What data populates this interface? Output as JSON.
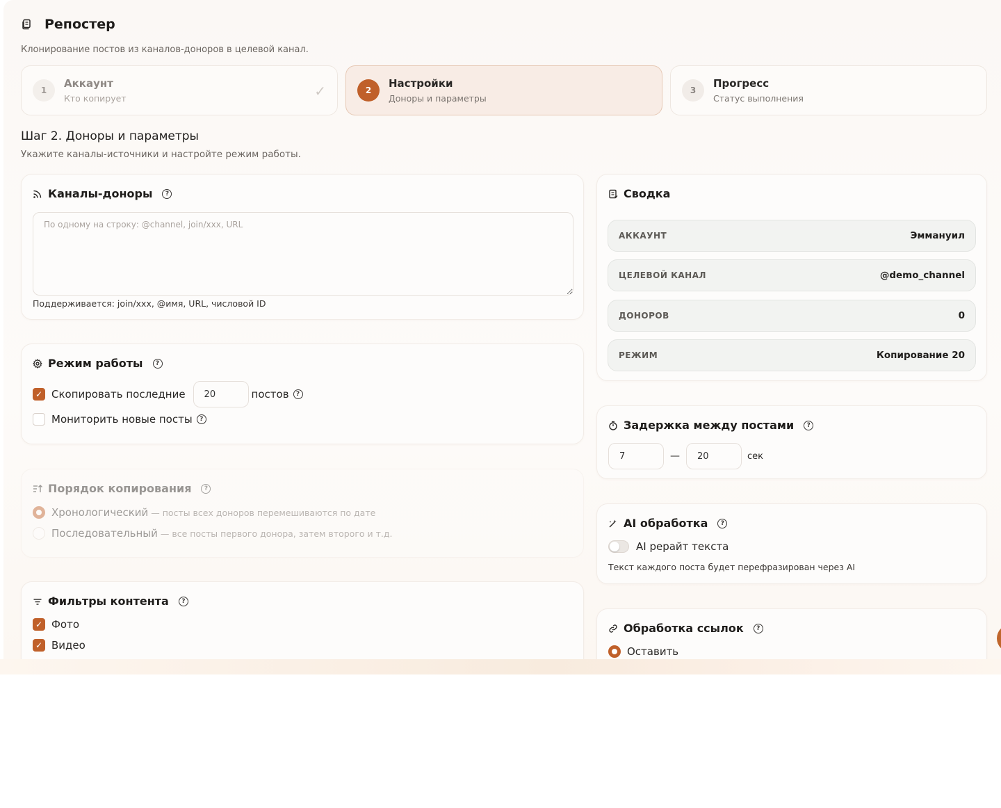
{
  "app": {
    "title": "Репостер",
    "subtitle": "Клонирование постов из каналов-доноров в целевой канал."
  },
  "steps": [
    {
      "num": "1",
      "title": "Аккаунт",
      "sub": "Кто копирует",
      "state": "done"
    },
    {
      "num": "2",
      "title": "Настройки",
      "sub": "Доноры и параметры",
      "state": "active"
    },
    {
      "num": "3",
      "title": "Прогресс",
      "sub": "Статус выполнения",
      "state": "pending"
    }
  ],
  "section": {
    "title": "Шаг 2. Доноры и параметры",
    "subtitle": "Укажите каналы-источники и настройте режим работы."
  },
  "donors": {
    "title": "Каналы-доноры",
    "placeholder": "По одному на строку: @channel, join/xxx, URL",
    "hint": "Поддерживается: join/xxx, @имя, URL, числовой ID"
  },
  "mode": {
    "title": "Режим работы",
    "copy_label": "Скопировать последние",
    "copy_count": "20",
    "copy_suffix": "постов",
    "monitor_label": "Мониторить новые посты"
  },
  "order": {
    "title": "Порядок копирования",
    "options": [
      {
        "label": "Хронологический",
        "desc": "— посты всех доноров перемешиваются по дате"
      },
      {
        "label": "Последовательный",
        "desc": "— все посты первого донора, затем второго и т.д."
      }
    ]
  },
  "filters": {
    "title": "Фильтры контента",
    "items": [
      {
        "label": "Фото"
      },
      {
        "label": "Видео"
      }
    ]
  },
  "summary": {
    "title": "Сводка",
    "rows": [
      {
        "key": "АККАУНТ",
        "value": "Эммануил"
      },
      {
        "key": "ЦЕЛЕВОЙ КАНАЛ",
        "value": "@demo_channel"
      },
      {
        "key": "ДОНОРОВ",
        "value": "0"
      },
      {
        "key": "РЕЖИМ",
        "value": "Копирование 20"
      }
    ]
  },
  "delay": {
    "title": "Задержка между постами",
    "min": "7",
    "max": "20",
    "dash": "—",
    "unit": "сек"
  },
  "ai": {
    "title": "AI обработка",
    "toggle_label": "AI рерайт текста",
    "note": "Текст каждого поста будет перефразирован через AI"
  },
  "links": {
    "title": "Обработка ссылок",
    "option": "Оставить"
  },
  "colors": {
    "accent": "#c0602a",
    "background": "#fbf8f5"
  }
}
